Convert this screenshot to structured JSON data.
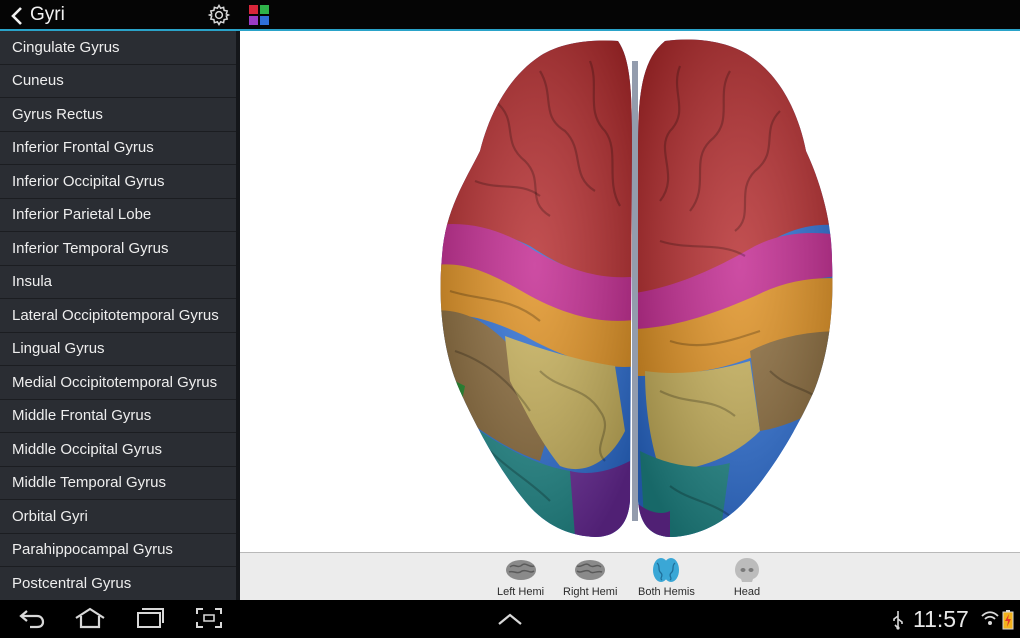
{
  "header": {
    "title": "Gyri"
  },
  "sidebar": {
    "items": [
      "Cingulate Gyrus",
      "Cuneus",
      "Gyrus Rectus",
      "Inferior Frontal Gyrus",
      "Inferior Occipital Gyrus",
      "Inferior Parietal Lobe",
      "Inferior Temporal Gyrus",
      "Insula",
      "Lateral Occipitotemporal Gyrus",
      "Lingual Gyrus",
      "Medial Occipitotemporal Gyrus",
      "Middle Frontal Gyrus",
      "Middle Occipital Gyrus",
      "Middle Temporal Gyrus",
      "Orbital Gyri",
      "Parahippocampal Gyrus",
      "Postcentral Gyrus"
    ]
  },
  "toolbar": {
    "tools": [
      {
        "label": "Left Hemi",
        "icon": "left-hemisphere-icon"
      },
      {
        "label": "Right Hemi",
        "icon": "right-hemisphere-icon"
      },
      {
        "label": "Both Hemis",
        "icon": "both-hemispheres-icon",
        "selected": true
      },
      {
        "label": "Head",
        "icon": "head-icon"
      }
    ]
  },
  "status": {
    "time": "11:57"
  },
  "colors": {
    "accent": "#2aa3c9",
    "sidebar_bg": "#2a2d33",
    "region_red": "#b52a2c",
    "region_magenta": "#c2268f",
    "region_orange": "#e0901f",
    "region_brown": "#8a6a3a",
    "region_khaki": "#c9b25a",
    "region_teal": "#1f8a8a",
    "region_blue": "#2c6fd6",
    "region_purple": "#6a2a9a",
    "region_green": "#1f8a2a"
  }
}
